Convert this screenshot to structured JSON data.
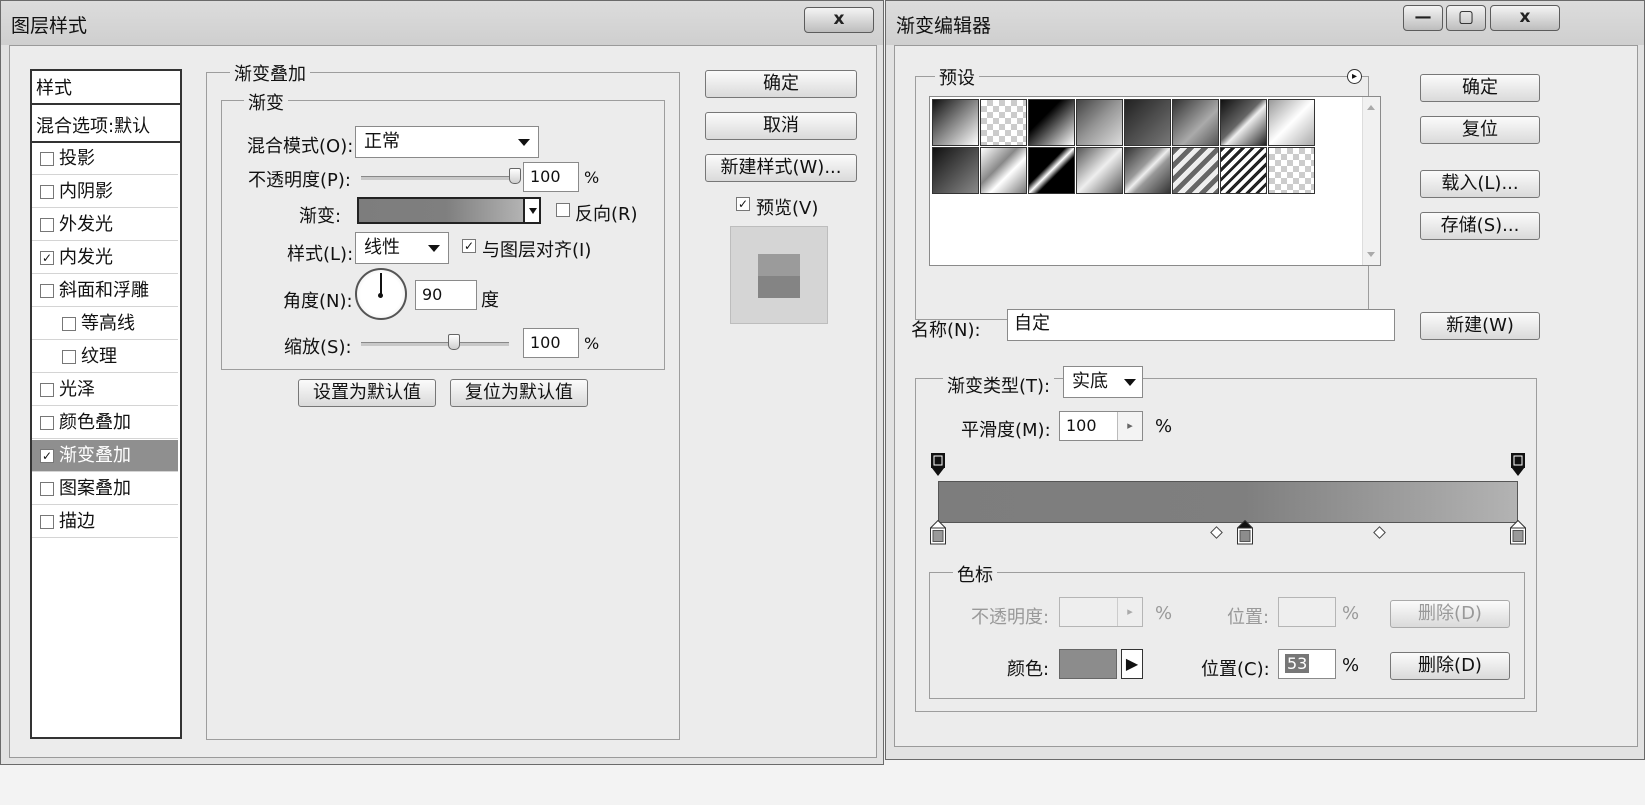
{
  "layer_style": {
    "title": "图层样式",
    "close_glyph": "x",
    "styles_header": "样式",
    "blend_options_item": "混合选项:默认",
    "style_items": [
      {
        "label": "投影",
        "checked": false,
        "indent": false,
        "selected": false
      },
      {
        "label": "内阴影",
        "checked": false,
        "indent": false,
        "selected": false
      },
      {
        "label": "外发光",
        "checked": false,
        "indent": false,
        "selected": false
      },
      {
        "label": "内发光",
        "checked": true,
        "indent": false,
        "selected": false
      },
      {
        "label": "斜面和浮雕",
        "checked": false,
        "indent": false,
        "selected": false
      },
      {
        "label": "等高线",
        "checked": false,
        "indent": true,
        "selected": false
      },
      {
        "label": "纹理",
        "checked": false,
        "indent": true,
        "selected": false
      },
      {
        "label": "光泽",
        "checked": false,
        "indent": false,
        "selected": false
      },
      {
        "label": "颜色叠加",
        "checked": false,
        "indent": false,
        "selected": false
      },
      {
        "label": "渐变叠加",
        "checked": true,
        "indent": false,
        "selected": true
      },
      {
        "label": "图案叠加",
        "checked": false,
        "indent": false,
        "selected": false
      },
      {
        "label": "描边",
        "checked": false,
        "indent": false,
        "selected": false
      }
    ],
    "section_title": "渐变叠加",
    "subsection_title": "渐变",
    "blend_mode_label": "混合模式(O):",
    "blend_mode_value": "正常",
    "opacity_label": "不透明度(P):",
    "opacity_value": "100",
    "opacity_level": 1.0,
    "percent": "%",
    "gradient_label": "渐变:",
    "reverse_label": "反向(R)",
    "reverse_checked": false,
    "style_label": "样式(L):",
    "style_value": "线性",
    "align_label": "与图层对齐(I)",
    "align_checked": true,
    "angle_label": "角度(N):",
    "angle_value": "90",
    "angle_unit": "度",
    "scale_label": "缩放(S):",
    "scale_value": "100",
    "scale_level": 0.63,
    "set_default_button": "设置为默认值",
    "reset_default_button": "复位为默认值",
    "ok_button": "确定",
    "cancel_button": "取消",
    "new_style_button": "新建样式(W)...",
    "preview_label": "预览(V)",
    "preview_checked": true,
    "check_glyph": "✓"
  },
  "gradient_editor": {
    "title": "渐变编辑器",
    "minimize_glyph": "—",
    "maximize_glyph": "▢",
    "close_glyph": "x",
    "presets_label": "预设",
    "presets_menu_glyph": "▸",
    "ok_button": "确定",
    "reset_button": "复位",
    "load_button": "载入(L)...",
    "save_button": "存储(S)...",
    "name_label": "名称(N):",
    "name_value": "自定",
    "new_button": "新建(W)",
    "gradient_type_label": "渐变类型(T):",
    "gradient_type_value": "实底",
    "smoothness_label": "平滑度(M):",
    "smoothness_value": "100",
    "stepper_glyph": "▸",
    "percent": "%",
    "color_stop_group": "色标",
    "opacity_label": "不透明度:",
    "location_label_disabled": "位置:",
    "delete_button": "删除(D)",
    "color_label": "颜色:",
    "color_swatch": "#8c8c8c",
    "color_arrow_glyph": "▶",
    "location_label": "位置(C):",
    "location_value": "53",
    "color_stops": [
      0,
      53,
      100
    ],
    "midpoints": [
      48,
      76
    ],
    "gradient_colors": [
      "#7d7d7d",
      "#7f7f7f",
      "#b3b3b3"
    ]
  }
}
